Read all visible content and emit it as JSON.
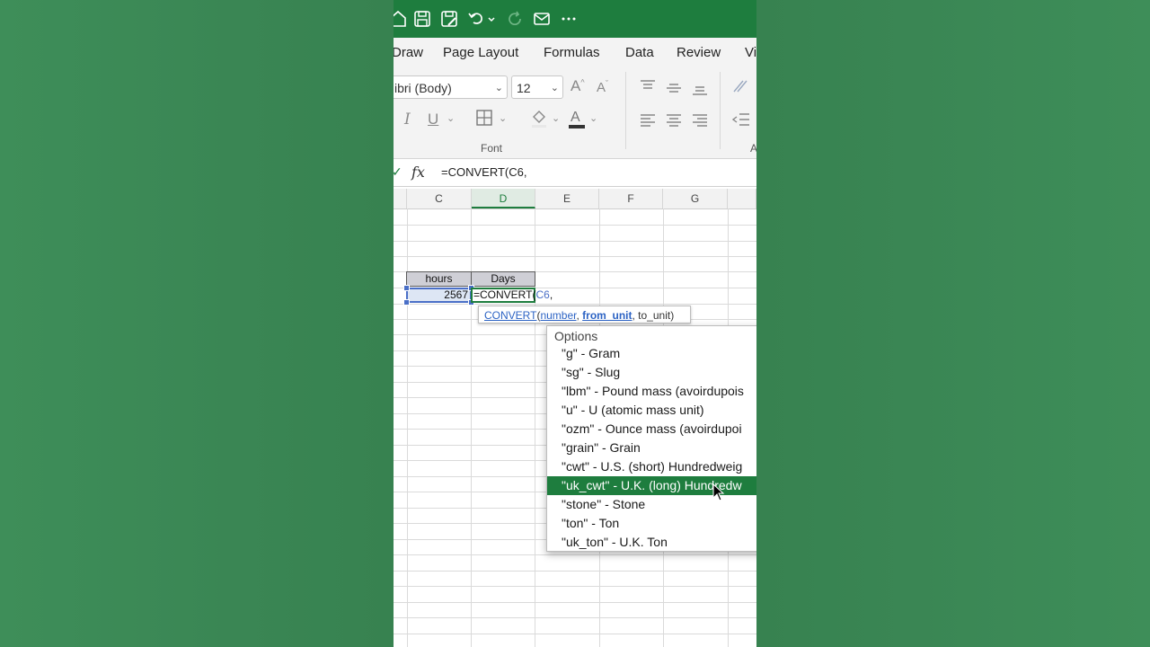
{
  "colors": {
    "brand": "#1e7d3e",
    "selection": "#4a6fc7",
    "background": "#3a8754"
  },
  "titlebar": {
    "icons": [
      "home-icon",
      "save-icon",
      "save-as-icon",
      "undo-icon",
      "redo-icon",
      "email-icon",
      "more-icon"
    ]
  },
  "ribbon": {
    "tabs": [
      "Draw",
      "Page Layout",
      "Formulas",
      "Data",
      "Review",
      "Vi"
    ],
    "font_name": "ibri (Body)",
    "font_size": "12",
    "group_font": "Font",
    "group_a": "A"
  },
  "formula_bar": {
    "fx": "fx",
    "text": "=CONVERT(C6,"
  },
  "grid": {
    "columns": [
      "C",
      "D",
      "E",
      "F",
      "G"
    ],
    "active_column": "D",
    "cells": {
      "c5": "hours",
      "d5": "Days",
      "c6": "2567",
      "d6_prefix": "=CONVERT(",
      "d6_ref": "C6",
      "d6_suffix": ","
    }
  },
  "tooltip": {
    "fn": "CONVERT",
    "open": "(",
    "arg1": "number",
    "sep1": ", ",
    "arg2": "from_unit",
    "sep2": ", to_unit)"
  },
  "dropdown": {
    "title": "Options",
    "items": [
      "\"g\" - Gram",
      "\"sg\" - Slug",
      "\"lbm\" - Pound mass (avoirdupois",
      "\"u\" - U (atomic mass unit)",
      "\"ozm\" - Ounce mass (avoirdupoi",
      "\"grain\" - Grain",
      "\"cwt\" - U.S. (short) Hundredweig",
      "\"uk_cwt\" - U.K. (long) Hundredw",
      "\"stone\" - Stone",
      "\"ton\" - Ton",
      "\"uk_ton\" - U.K. Ton"
    ],
    "selected_index": 7
  }
}
